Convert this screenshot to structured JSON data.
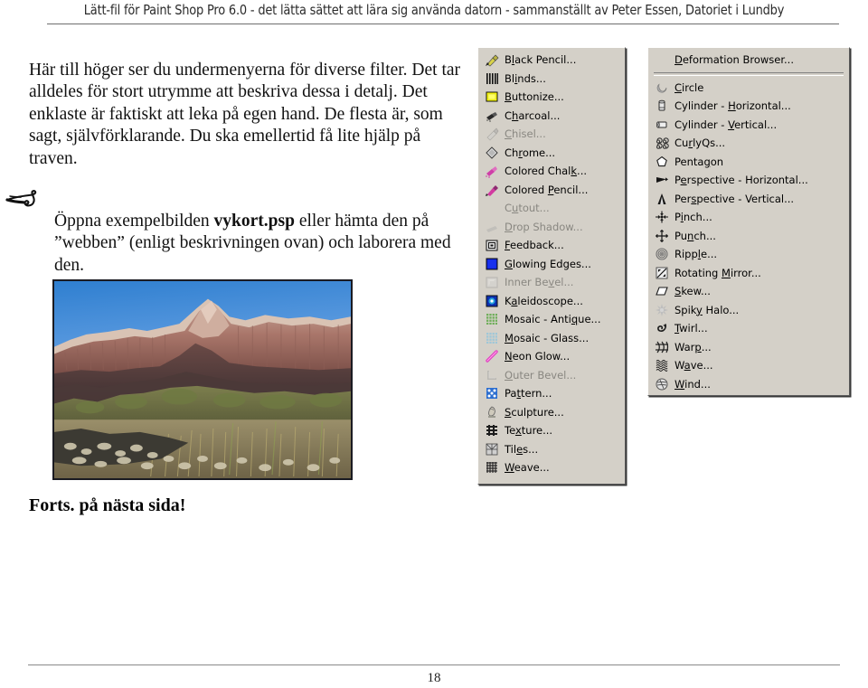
{
  "header": {
    "title": "Lätt-fil för Paint Shop Pro 6.0 - det lätta sättet att lära sig använda datorn - sammanställt av Peter Essen, Datoriet i Lundby"
  },
  "body": {
    "intro_paragraph": "Här till höger ser du  undermenyerna för diverse filter. Det tar alldeles för stort utrymme att beskriva dessa i detalj. Det enklaste är faktiskt att leka på egen hand. De flesta är, som sagt, självförklarande. Du ska emellertid få lite hjälp på traven.",
    "tip_paragraph_before": "Öppna exempelbilden ",
    "tip_paragraph_bold": "vykort.psp",
    "tip_paragraph_after": " eller hämta den på ”webben” (enligt beskrivningen ovan) och laborera med den.",
    "ornament_icon": "pen-flourish-icon",
    "photo_alt": "desert-canyon-landscape-photo",
    "continued_note": "Forts. på nästa sida!"
  },
  "footer": {
    "page_number": "18"
  },
  "menu_effects": {
    "name": "effects-submenu",
    "items": [
      {
        "label": "Black Pencil...",
        "accel": "l",
        "icon": "black-pencil-icon",
        "disabled": false
      },
      {
        "label": "Blinds...",
        "accel": "i",
        "icon": "blinds-icon",
        "disabled": false
      },
      {
        "label": "Buttonize...",
        "accel": "B",
        "icon": "buttonize-icon",
        "disabled": false
      },
      {
        "label": "Charcoal...",
        "accel": "h",
        "icon": "charcoal-icon",
        "disabled": false
      },
      {
        "label": "Chisel...",
        "accel": "C",
        "icon": "chisel-icon",
        "disabled": true
      },
      {
        "label": "Chrome...",
        "accel": "r",
        "icon": "chrome-icon",
        "disabled": false
      },
      {
        "label": "Colored Chalk...",
        "accel": "k",
        "icon": "colored-chalk-icon",
        "disabled": false
      },
      {
        "label": "Colored Pencil...",
        "accel": "P",
        "icon": "colored-pencil-icon",
        "disabled": false
      },
      {
        "label": "Cutout...",
        "accel": "u",
        "icon": "cutout-icon",
        "disabled": true
      },
      {
        "label": "Drop Shadow...",
        "accel": "D",
        "icon": "drop-shadow-icon",
        "disabled": true
      },
      {
        "label": "Feedback...",
        "accel": "F",
        "icon": "feedback-icon",
        "disabled": false
      },
      {
        "label": "Glowing Edges...",
        "accel": "G",
        "icon": "glowing-edges-icon",
        "disabled": false
      },
      {
        "label": "Inner Bevel...",
        "accel": "v",
        "icon": "inner-bevel-icon",
        "disabled": true
      },
      {
        "label": "Kaleidoscope...",
        "accel": "a",
        "icon": "kaleidoscope-icon",
        "disabled": false
      },
      {
        "label": "Mosaic - Antique...",
        "accel": "q",
        "icon": "mosaic-antique-icon",
        "disabled": false
      },
      {
        "label": "Mosaic - Glass...",
        "accel": "M",
        "icon": "mosaic-glass-icon",
        "disabled": false
      },
      {
        "label": "Neon Glow...",
        "accel": "N",
        "icon": "neon-glow-icon",
        "disabled": false
      },
      {
        "label": "Outer Bevel...",
        "accel": "O",
        "icon": "outer-bevel-icon",
        "disabled": true
      },
      {
        "label": "Pattern...",
        "accel": "t",
        "icon": "pattern-icon",
        "disabled": false
      },
      {
        "label": "Sculpture...",
        "accel": "S",
        "icon": "sculpture-icon",
        "disabled": false
      },
      {
        "label": "Texture...",
        "accel": "x",
        "icon": "texture-icon",
        "disabled": false
      },
      {
        "label": "Tiles...",
        "accel": "e",
        "icon": "tiles-icon",
        "disabled": false
      },
      {
        "label": "Weave...",
        "accel": "W",
        "icon": "weave-icon",
        "disabled": false
      }
    ]
  },
  "menu_deformations": {
    "name": "deformations-submenu",
    "browser_item": {
      "label": "Deformation Browser...",
      "accel": "D",
      "icon": null,
      "disabled": false
    },
    "items": [
      {
        "label": "Circle",
        "accel": "C",
        "icon": "circle-icon",
        "disabled": false
      },
      {
        "label": "Cylinder - Horizontal...",
        "accel": "H",
        "icon": "cylinder-horizontal-icon",
        "disabled": false
      },
      {
        "label": "Cylinder - Vertical...",
        "accel": "V",
        "icon": "cylinder-vertical-icon",
        "disabled": false
      },
      {
        "label": "CurlyQs...",
        "accel": "r",
        "icon": "curlyqs-icon",
        "disabled": false
      },
      {
        "label": "Pentagon",
        "accel": "g",
        "icon": "pentagon-icon",
        "disabled": false
      },
      {
        "label": "Perspective - Horizontal...",
        "accel": "e",
        "icon": "perspective-horizontal-icon",
        "disabled": false
      },
      {
        "label": "Perspective - Vertical...",
        "accel": "s",
        "icon": "perspective-vertical-icon",
        "disabled": false
      },
      {
        "label": "Pinch...",
        "accel": "i",
        "icon": "pinch-icon",
        "disabled": false
      },
      {
        "label": "Punch...",
        "accel": "n",
        "icon": "punch-icon",
        "disabled": false
      },
      {
        "label": "Ripple...",
        "accel": "l",
        "icon": "ripple-icon",
        "disabled": false
      },
      {
        "label": "Rotating Mirror...",
        "accel": "M",
        "icon": "rotating-mirror-icon",
        "disabled": false
      },
      {
        "label": "Skew...",
        "accel": "S",
        "icon": "skew-icon",
        "disabled": false
      },
      {
        "label": "Spiky Halo...",
        "accel": "y",
        "icon": "spiky-halo-icon",
        "disabled": false
      },
      {
        "label": "Twirl...",
        "accel": "T",
        "icon": "twirl-icon",
        "disabled": false
      },
      {
        "label": "Warp...",
        "accel": "p",
        "icon": "warp-icon",
        "disabled": false
      },
      {
        "label": "Wave...",
        "accel": "a",
        "icon": "wave-icon",
        "disabled": false
      },
      {
        "label": "Wind...",
        "accel": "W",
        "icon": "wind-icon",
        "disabled": false
      }
    ]
  },
  "colors": {
    "menu_face": "#d4d0c8",
    "disabled_text": "#898781",
    "sky": "#4a90d9",
    "cliff": "#a9786a"
  }
}
